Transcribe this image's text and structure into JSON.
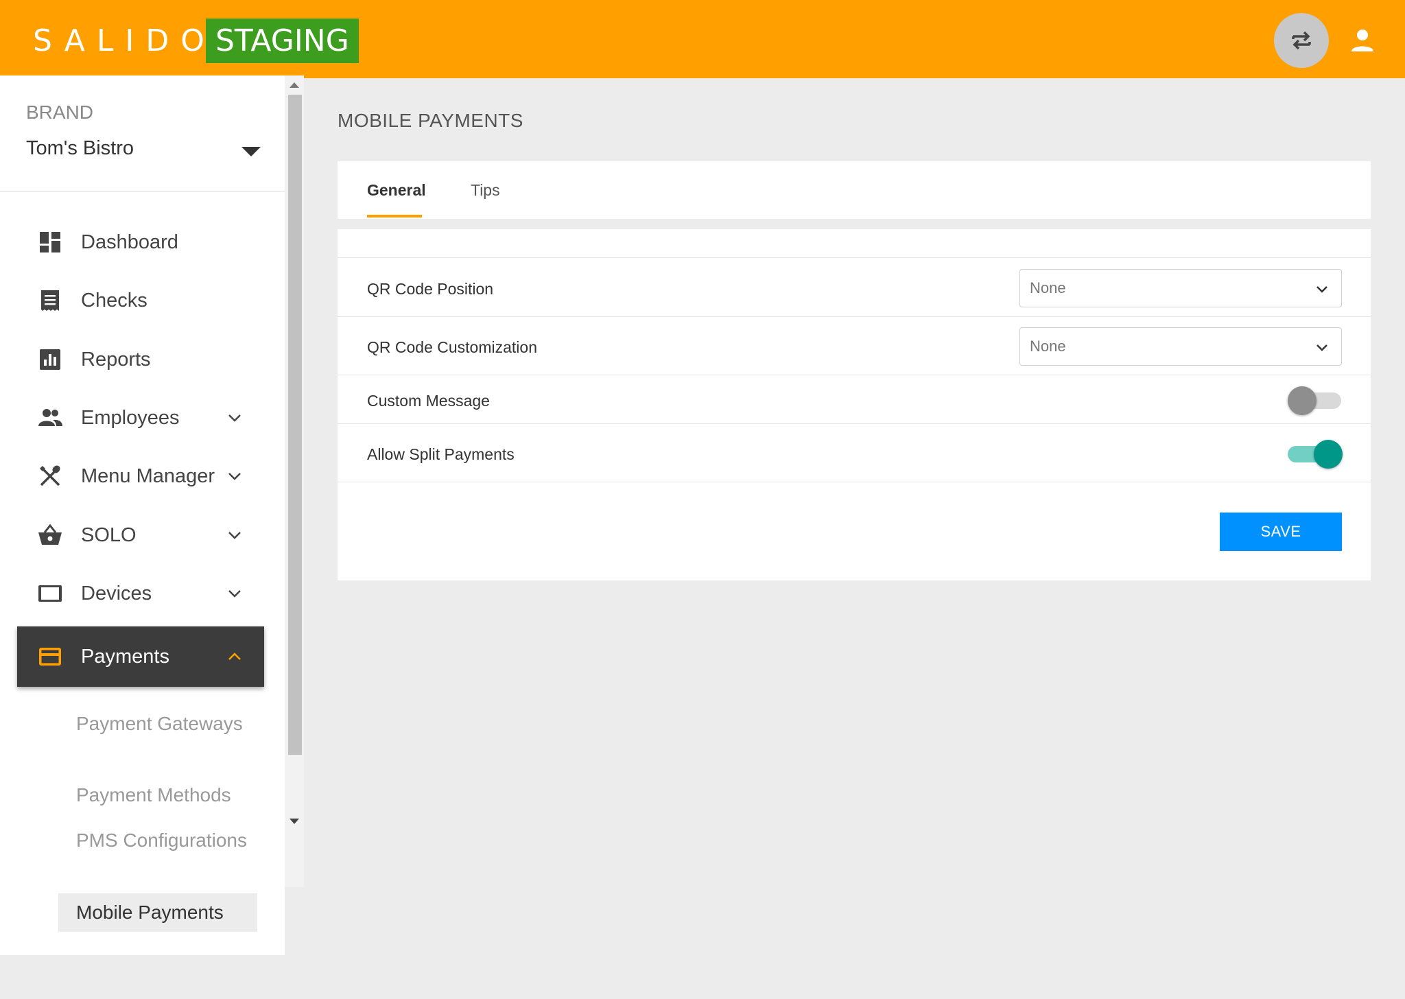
{
  "header": {
    "logo_text": "SALIDO",
    "environment_badge": "STAGING",
    "swap_icon": "swap-arrows-icon",
    "user_icon": "user-icon",
    "colors": {
      "header_bg": "#ffa000",
      "badge_bg": "#3c9d1f"
    }
  },
  "sidebar": {
    "brand_label": "BRAND",
    "brand_value": "Tom's Bistro",
    "nav_items": [
      {
        "label": "Dashboard",
        "icon": "dashboard-icon",
        "expandable": false
      },
      {
        "label": "Checks",
        "icon": "receipt-icon",
        "expandable": false
      },
      {
        "label": "Reports",
        "icon": "bar-chart-icon",
        "expandable": false
      },
      {
        "label": "Employees",
        "icon": "people-icon",
        "expandable": true
      },
      {
        "label": "Menu Manager",
        "icon": "utensils-icon",
        "expandable": true
      },
      {
        "label": "SOLO",
        "icon": "basket-icon",
        "expandable": true
      },
      {
        "label": "Devices",
        "icon": "tablet-icon",
        "expandable": true
      },
      {
        "label": "Payments",
        "icon": "credit-card-icon",
        "expandable": true,
        "active": true,
        "expanded": true
      }
    ],
    "payments_sub_items": [
      {
        "label": "Payment Gateways"
      },
      {
        "label": "Payment Methods"
      },
      {
        "label": "PMS Configurations"
      },
      {
        "label": "Mobile Payments",
        "active": true
      }
    ]
  },
  "main": {
    "page_title": "MOBILE PAYMENTS",
    "tabs": [
      {
        "label": "General",
        "active": true
      },
      {
        "label": "Tips",
        "active": false
      }
    ],
    "settings": {
      "qr_position": {
        "label": "QR Code Position",
        "value": "None"
      },
      "qr_customization": {
        "label": "QR Code Customization",
        "value": "None"
      },
      "custom_message": {
        "label": "Custom Message",
        "enabled": false
      },
      "allow_split": {
        "label": "Allow Split Payments",
        "enabled": true
      }
    },
    "save_label": "SAVE",
    "colors": {
      "accent": "#ffa000",
      "save_bg": "#0091ff",
      "toggle_on": "#009688"
    }
  }
}
